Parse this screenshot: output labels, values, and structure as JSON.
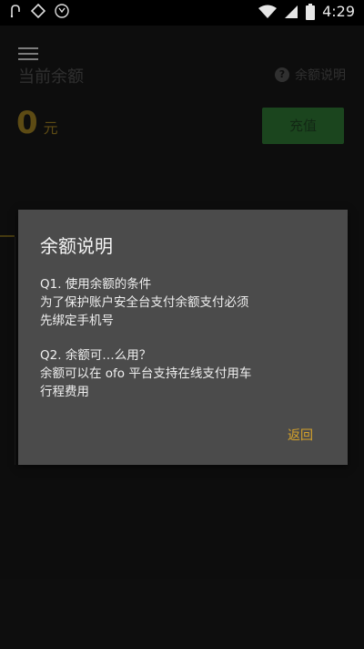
{
  "status_bar": {
    "time": "4:29",
    "left_icons": [
      "usb-icon",
      "sync-icon",
      "app-badge-icon"
    ],
    "right_icons": [
      "wifi-icon",
      "signal-icon",
      "battery-icon"
    ]
  },
  "header": {
    "balance_label": "当前余额",
    "help_link_label": "余额说明"
  },
  "balance": {
    "amount": "0",
    "unit": "元"
  },
  "actions": {
    "topup_label": "充值"
  },
  "dialog": {
    "title": "余额说明",
    "q1": {
      "question": "Q1. 使用余额的条件",
      "answer_line1": "为了保护账户安全台支付余额支付必须",
      "answer_line2": "先绑定手机号"
    },
    "q2": {
      "question": "Q2. 余额可…么用？",
      "answer_line1": "余额可以在 ofo 平台支持在线支付用车",
      "answer_line2": "行程费用"
    },
    "ok_label": "返回"
  },
  "colors": {
    "accent_gold": "#d7a32a",
    "topup_green": "#2a6a2f",
    "dialog_bg": "#4b4b4b"
  }
}
